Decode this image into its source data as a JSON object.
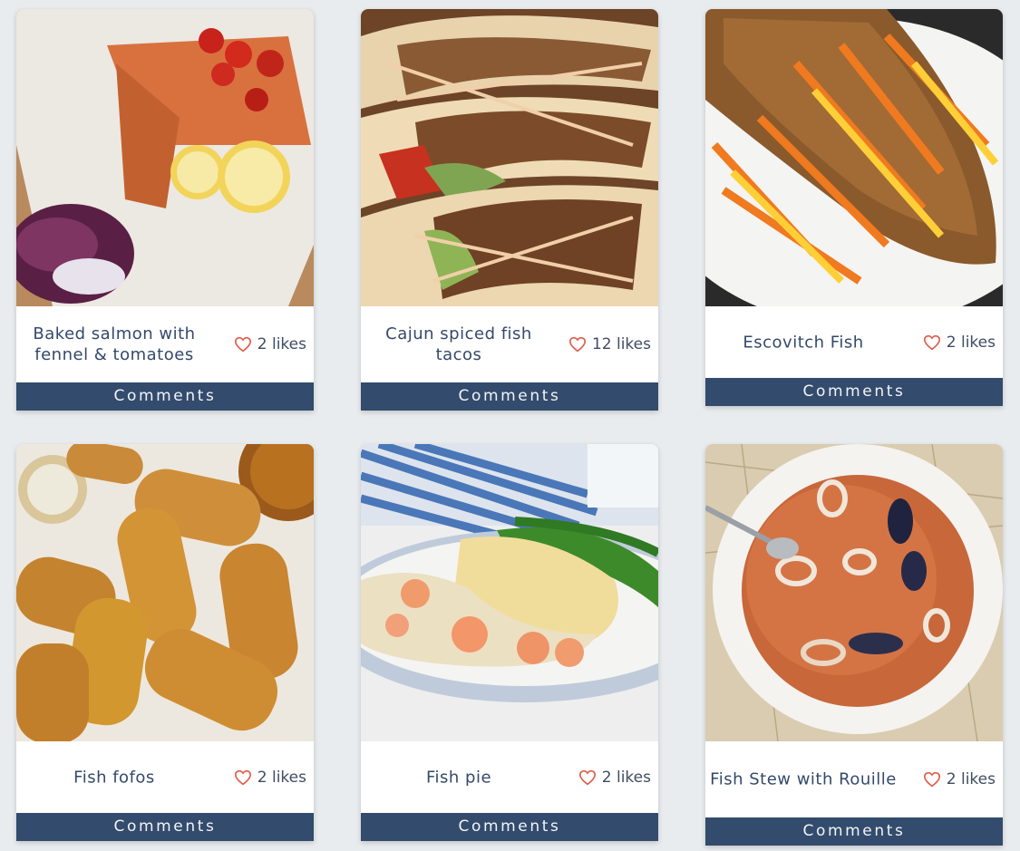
{
  "colors": {
    "page_bg": "#e9ecef",
    "title_text": "#34496b",
    "comments_bg": "#334b6c",
    "heart": "#e05a45"
  },
  "cards": [
    {
      "title": "Baked salmon with fennel & tomatoes",
      "likes": "2 likes",
      "comments": "Comments",
      "photo": "baked salmon with lemon, cherry tomatoes and red cabbage slaw"
    },
    {
      "title": "Cajun spiced fish tacos",
      "likes": "12 likes",
      "comments": "Comments",
      "photo": "fish tacos drizzled with sauce"
    },
    {
      "title": "Escovitch Fish",
      "likes": "2 likes",
      "comments": "Comments",
      "photo": "fried whole fish with pickled carrots and peppers"
    },
    {
      "title": "Fish fofos",
      "likes": "2 likes",
      "comments": "Comments",
      "photo": "breaded fish croquettes with dipping sauce"
    },
    {
      "title": "Fish pie",
      "likes": "2 likes",
      "comments": "Comments",
      "photo": "fish pie with prawns and green beans"
    },
    {
      "title": "Fish Stew with Rouille",
      "likes": "2 likes",
      "comments": "Comments",
      "photo": "seafood stew with mussels and squid in a white bowl"
    }
  ]
}
